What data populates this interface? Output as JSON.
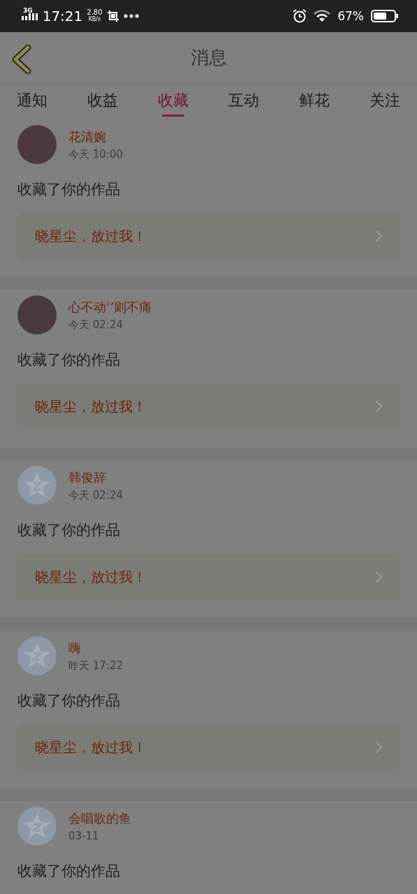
{
  "status_bar": {
    "network": "3G",
    "time": "17:21",
    "speed": "2.80",
    "speed_unit": "KB/s",
    "battery": "67%"
  },
  "header": {
    "title": "消息"
  },
  "tabs": [
    {
      "label": "通知",
      "selected": false
    },
    {
      "label": "收益",
      "selected": false
    },
    {
      "label": "收藏",
      "selected": true
    },
    {
      "label": "互动",
      "selected": false
    },
    {
      "label": "鲜花",
      "selected": false
    },
    {
      "label": "关注",
      "selected": false
    }
  ],
  "messages": [
    {
      "kind": "photo",
      "name": "花清婉",
      "time": "今天 10:00",
      "action": "收藏了你的作品",
      "work": "晓星尘，放过我！"
    },
    {
      "kind": "photo",
      "name": "心不动‘’则不痛",
      "time": "今天 02:24",
      "action": "收藏了你的作品",
      "work": "晓星尘，放过我！"
    },
    {
      "kind": "default",
      "name": "韩俊辞",
      "time": "今天 02:24",
      "action": "收藏了你的作品",
      "work": "晓星尘，放过我！"
    },
    {
      "kind": "default",
      "name": "嗨",
      "time": "昨天 17:22",
      "action": "收藏了你的作品",
      "work": "晓星尘，放过我！"
    },
    {
      "kind": "default",
      "name": "会唱歌的鱼",
      "time": "03-11",
      "action": "收藏了你的作品"
    }
  ]
}
